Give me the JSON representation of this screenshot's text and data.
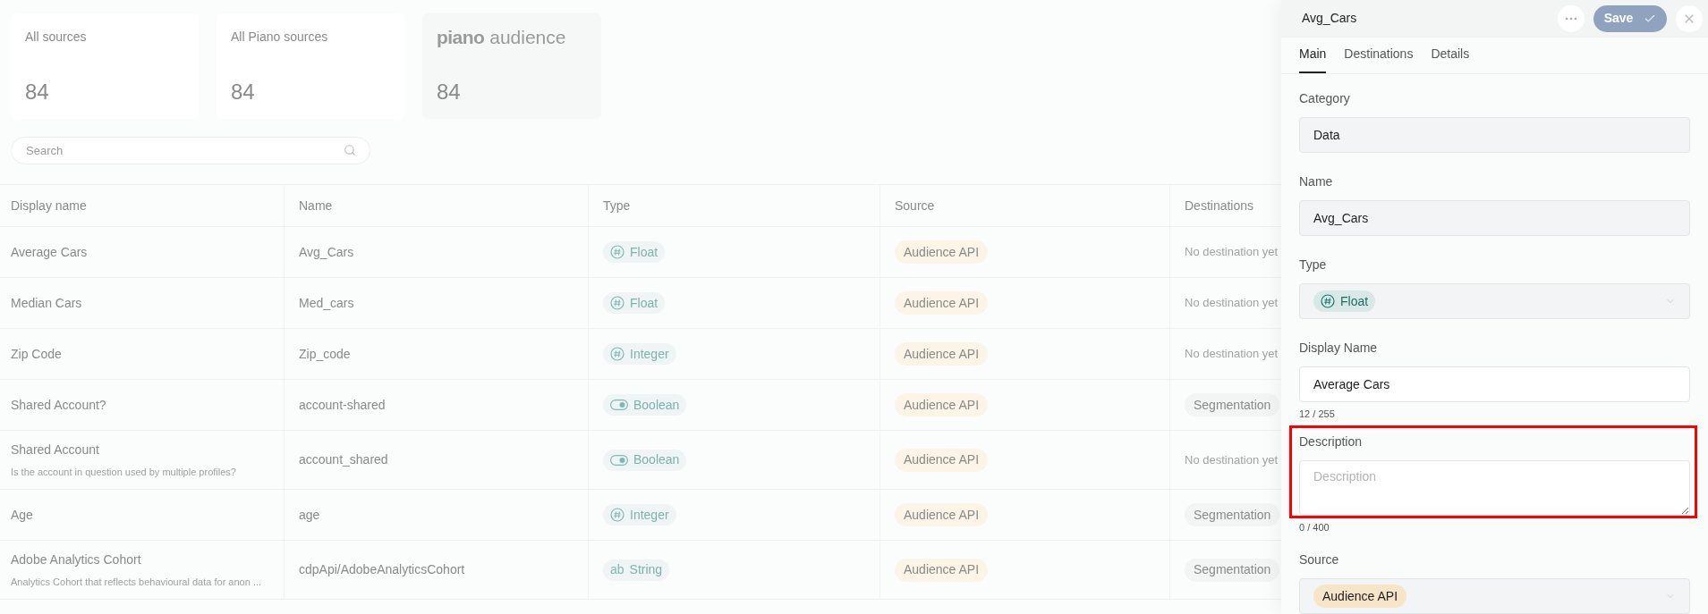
{
  "cards": [
    {
      "title": "All sources",
      "count": "84",
      "selected": false
    },
    {
      "title": "All Piano sources",
      "count": "84",
      "selected": false
    },
    {
      "brand": "piano",
      "product": "audience",
      "count": "84",
      "selected": true
    }
  ],
  "search": {
    "placeholder": "Search"
  },
  "table": {
    "columns": [
      "Display name",
      "Name",
      "Type",
      "Source",
      "Destinations"
    ],
    "rows": [
      {
        "display_name": "Average Cars",
        "name": "Avg_Cars",
        "type": {
          "kind": "number",
          "label": "Float"
        },
        "source": "Audience API",
        "destinations": {
          "empty_text": "No destination yet"
        }
      },
      {
        "display_name": "Median Cars",
        "name": "Med_cars",
        "type": {
          "kind": "number",
          "label": "Float"
        },
        "source": "Audience API",
        "destinations": {
          "empty_text": "No destination yet"
        }
      },
      {
        "display_name": "Zip Code",
        "name": "Zip_code",
        "type": {
          "kind": "number",
          "label": "Integer"
        },
        "source": "Audience API",
        "destinations": {
          "empty_text": "No destination yet"
        }
      },
      {
        "display_name": "Shared Account?",
        "name": "account-shared",
        "type": {
          "kind": "boolean",
          "label": "Boolean"
        },
        "source": "Audience API",
        "destinations": {
          "tags": [
            "Segmentation"
          ]
        }
      },
      {
        "display_name": "Shared Account",
        "description": "Is the account in question used by multiple profiles?",
        "name": "account_shared",
        "type": {
          "kind": "boolean",
          "label": "Boolean"
        },
        "source": "Audience API",
        "destinations": {
          "empty_text": "No destination yet"
        }
      },
      {
        "display_name": "Age",
        "name": "age",
        "type": {
          "kind": "number",
          "label": "Integer"
        },
        "source": "Audience API",
        "destinations": {
          "tags": [
            "Segmentation"
          ]
        }
      },
      {
        "display_name": "Adobe Analytics Cohort",
        "description": "Analytics Cohort that reflects behavioural data for anon ...",
        "name": "cdpApi/AdobeAnalyticsCohort",
        "type": {
          "kind": "string",
          "icon_text": "ab",
          "label": "String"
        },
        "source": "Audience API",
        "destinations": {
          "tags": [
            "Segmentation"
          ]
        }
      }
    ]
  },
  "panel": {
    "title": "Avg_Cars",
    "save": {
      "label": "Save",
      "disabled": true
    },
    "tabs": [
      {
        "label": "Main",
        "selected": true
      },
      {
        "label": "Destinations",
        "selected": false
      },
      {
        "label": "Details",
        "selected": false
      }
    ],
    "category": {
      "label": "Category",
      "value": "Data"
    },
    "name": {
      "label": "Name",
      "value": "Avg_Cars"
    },
    "type": {
      "label": "Type",
      "kind": "number",
      "value": "Float"
    },
    "display_name": {
      "label": "Display Name",
      "value": "Average Cars",
      "counter": "12 / 255"
    },
    "description": {
      "label": "Description",
      "placeholder": "Description",
      "counter": "0 / 400",
      "highlighted": true
    },
    "source": {
      "label": "Source",
      "value": "Audience API"
    }
  }
}
